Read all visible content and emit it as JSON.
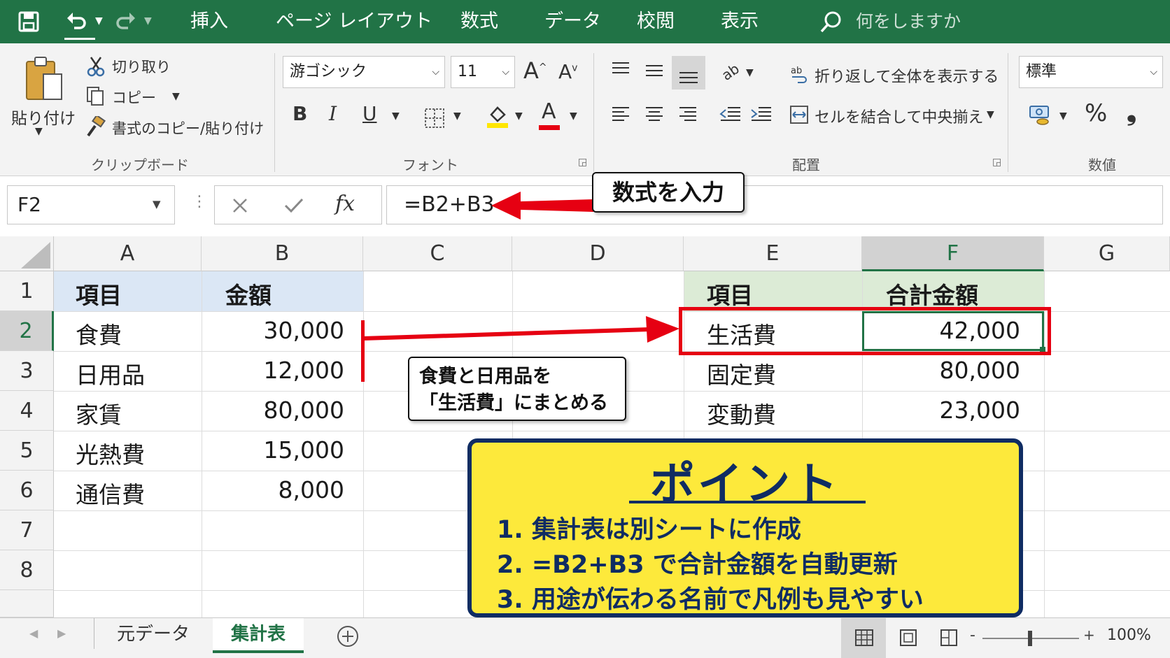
{
  "menu": {
    "items": [
      "挿入",
      "ページ レイアウト",
      "数式",
      "データ",
      "校閲",
      "表示"
    ],
    "search_placeholder": "何をしますか"
  },
  "clipboard": {
    "paste": "貼り付け",
    "cut": "切り取り",
    "copy": "コピー",
    "format_painter": "書式のコピー/貼り付け",
    "group_label": "クリップボード"
  },
  "font": {
    "name": "游ゴシック",
    "size": "11",
    "grow": "A",
    "shrink": "A",
    "bold": "B",
    "italic": "I",
    "underline": "U",
    "font_color_letter": "A",
    "group_label": "フォント"
  },
  "alignment": {
    "wrap_text": "折り返して全体を表示する",
    "merge_center": "セルを結合して中央揃え",
    "group_label": "配置"
  },
  "number": {
    "format": "標準",
    "percent": "%",
    "comma": "❟",
    "group_label": "数値"
  },
  "formula_bar": {
    "name_box": "F2",
    "fx": "fx",
    "formula": "=B2+B3"
  },
  "columns": [
    "A",
    "B",
    "C",
    "D",
    "E",
    "F",
    "G"
  ],
  "rows": [
    "1",
    "2",
    "3",
    "4",
    "5",
    "6",
    "7",
    "8"
  ],
  "source_table": {
    "headers": [
      "項目",
      "金額"
    ],
    "rows": [
      [
        "食費",
        "30,000"
      ],
      [
        "日用品",
        "12,000"
      ],
      [
        "家賃",
        "80,000"
      ],
      [
        "光熱費",
        "15,000"
      ],
      [
        "通信費",
        "8,000"
      ]
    ]
  },
  "summary_table": {
    "headers": [
      "項目",
      "合計金額"
    ],
    "rows": [
      [
        "生活費",
        "42,000"
      ],
      [
        "固定費",
        "80,000"
      ],
      [
        "変動費",
        "23,000"
      ]
    ]
  },
  "annotations": {
    "formula_callout": "数式を入力",
    "merge_callout_line1": "食費と日用品を",
    "merge_callout_line2": "「生活費」にまとめる",
    "point_title": "ポイント",
    "points": [
      "1. 集計表は別シートに作成",
      "2. =B2+B3 で合計金額を自動更新",
      "3. 用途が伝わる名前で凡例も見やすい"
    ]
  },
  "sheets": {
    "tabs": [
      "元データ",
      "集計表"
    ],
    "active": "集計表"
  },
  "status": {
    "zoom": "100%"
  },
  "colors": {
    "excel_green": "#217346",
    "header_blue": "#dbe7f5",
    "header_green": "#dcebd6",
    "highlight_red": "#e60012",
    "point_yellow": "#fde93b",
    "point_navy": "#0f2c63"
  }
}
